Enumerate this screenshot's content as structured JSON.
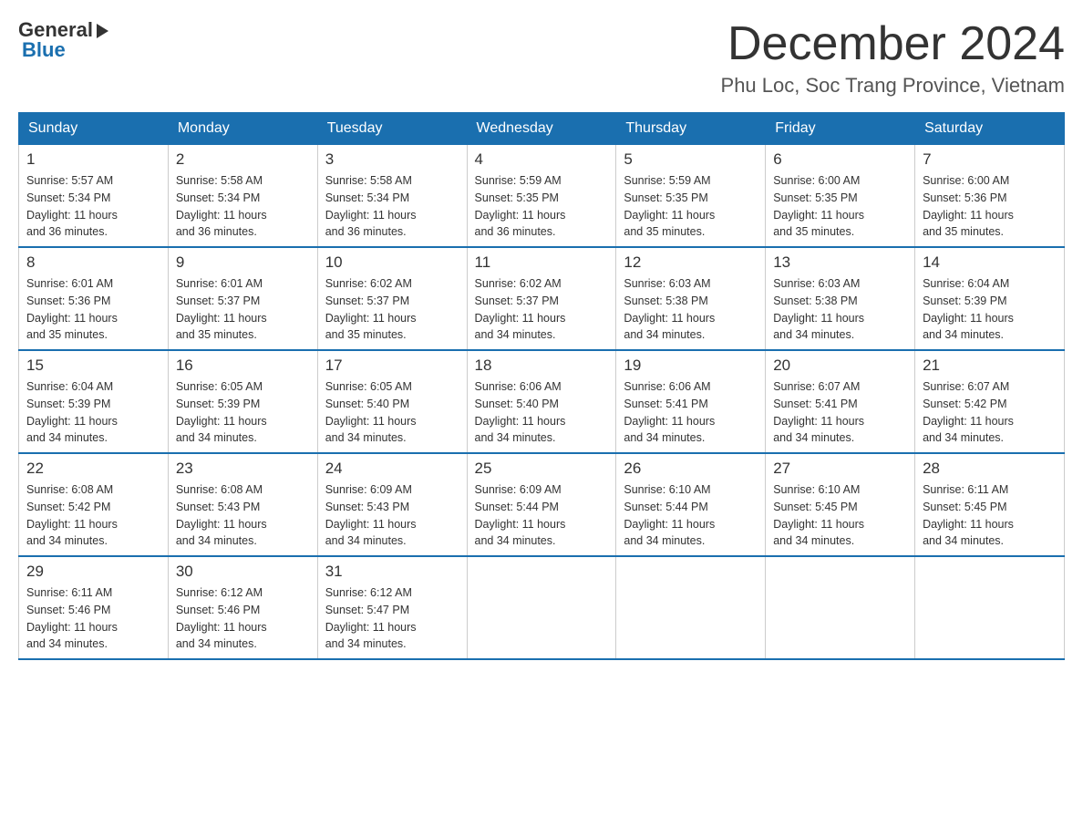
{
  "header": {
    "logo_general": "General",
    "logo_blue": "Blue",
    "title": "December 2024",
    "subtitle": "Phu Loc, Soc Trang Province, Vietnam"
  },
  "weekdays": [
    "Sunday",
    "Monday",
    "Tuesday",
    "Wednesday",
    "Thursday",
    "Friday",
    "Saturday"
  ],
  "weeks": [
    [
      {
        "day": "1",
        "sunrise": "5:57 AM",
        "sunset": "5:34 PM",
        "daylight": "11 hours and 36 minutes."
      },
      {
        "day": "2",
        "sunrise": "5:58 AM",
        "sunset": "5:34 PM",
        "daylight": "11 hours and 36 minutes."
      },
      {
        "day": "3",
        "sunrise": "5:58 AM",
        "sunset": "5:34 PM",
        "daylight": "11 hours and 36 minutes."
      },
      {
        "day": "4",
        "sunrise": "5:59 AM",
        "sunset": "5:35 PM",
        "daylight": "11 hours and 36 minutes."
      },
      {
        "day": "5",
        "sunrise": "5:59 AM",
        "sunset": "5:35 PM",
        "daylight": "11 hours and 35 minutes."
      },
      {
        "day": "6",
        "sunrise": "6:00 AM",
        "sunset": "5:35 PM",
        "daylight": "11 hours and 35 minutes."
      },
      {
        "day": "7",
        "sunrise": "6:00 AM",
        "sunset": "5:36 PM",
        "daylight": "11 hours and 35 minutes."
      }
    ],
    [
      {
        "day": "8",
        "sunrise": "6:01 AM",
        "sunset": "5:36 PM",
        "daylight": "11 hours and 35 minutes."
      },
      {
        "day": "9",
        "sunrise": "6:01 AM",
        "sunset": "5:37 PM",
        "daylight": "11 hours and 35 minutes."
      },
      {
        "day": "10",
        "sunrise": "6:02 AM",
        "sunset": "5:37 PM",
        "daylight": "11 hours and 35 minutes."
      },
      {
        "day": "11",
        "sunrise": "6:02 AM",
        "sunset": "5:37 PM",
        "daylight": "11 hours and 34 minutes."
      },
      {
        "day": "12",
        "sunrise": "6:03 AM",
        "sunset": "5:38 PM",
        "daylight": "11 hours and 34 minutes."
      },
      {
        "day": "13",
        "sunrise": "6:03 AM",
        "sunset": "5:38 PM",
        "daylight": "11 hours and 34 minutes."
      },
      {
        "day": "14",
        "sunrise": "6:04 AM",
        "sunset": "5:39 PM",
        "daylight": "11 hours and 34 minutes."
      }
    ],
    [
      {
        "day": "15",
        "sunrise": "6:04 AM",
        "sunset": "5:39 PM",
        "daylight": "11 hours and 34 minutes."
      },
      {
        "day": "16",
        "sunrise": "6:05 AM",
        "sunset": "5:39 PM",
        "daylight": "11 hours and 34 minutes."
      },
      {
        "day": "17",
        "sunrise": "6:05 AM",
        "sunset": "5:40 PM",
        "daylight": "11 hours and 34 minutes."
      },
      {
        "day": "18",
        "sunrise": "6:06 AM",
        "sunset": "5:40 PM",
        "daylight": "11 hours and 34 minutes."
      },
      {
        "day": "19",
        "sunrise": "6:06 AM",
        "sunset": "5:41 PM",
        "daylight": "11 hours and 34 minutes."
      },
      {
        "day": "20",
        "sunrise": "6:07 AM",
        "sunset": "5:41 PM",
        "daylight": "11 hours and 34 minutes."
      },
      {
        "day": "21",
        "sunrise": "6:07 AM",
        "sunset": "5:42 PM",
        "daylight": "11 hours and 34 minutes."
      }
    ],
    [
      {
        "day": "22",
        "sunrise": "6:08 AM",
        "sunset": "5:42 PM",
        "daylight": "11 hours and 34 minutes."
      },
      {
        "day": "23",
        "sunrise": "6:08 AM",
        "sunset": "5:43 PM",
        "daylight": "11 hours and 34 minutes."
      },
      {
        "day": "24",
        "sunrise": "6:09 AM",
        "sunset": "5:43 PM",
        "daylight": "11 hours and 34 minutes."
      },
      {
        "day": "25",
        "sunrise": "6:09 AM",
        "sunset": "5:44 PM",
        "daylight": "11 hours and 34 minutes."
      },
      {
        "day": "26",
        "sunrise": "6:10 AM",
        "sunset": "5:44 PM",
        "daylight": "11 hours and 34 minutes."
      },
      {
        "day": "27",
        "sunrise": "6:10 AM",
        "sunset": "5:45 PM",
        "daylight": "11 hours and 34 minutes."
      },
      {
        "day": "28",
        "sunrise": "6:11 AM",
        "sunset": "5:45 PM",
        "daylight": "11 hours and 34 minutes."
      }
    ],
    [
      {
        "day": "29",
        "sunrise": "6:11 AM",
        "sunset": "5:46 PM",
        "daylight": "11 hours and 34 minutes."
      },
      {
        "day": "30",
        "sunrise": "6:12 AM",
        "sunset": "5:46 PM",
        "daylight": "11 hours and 34 minutes."
      },
      {
        "day": "31",
        "sunrise": "6:12 AM",
        "sunset": "5:47 PM",
        "daylight": "11 hours and 34 minutes."
      },
      null,
      null,
      null,
      null
    ]
  ]
}
